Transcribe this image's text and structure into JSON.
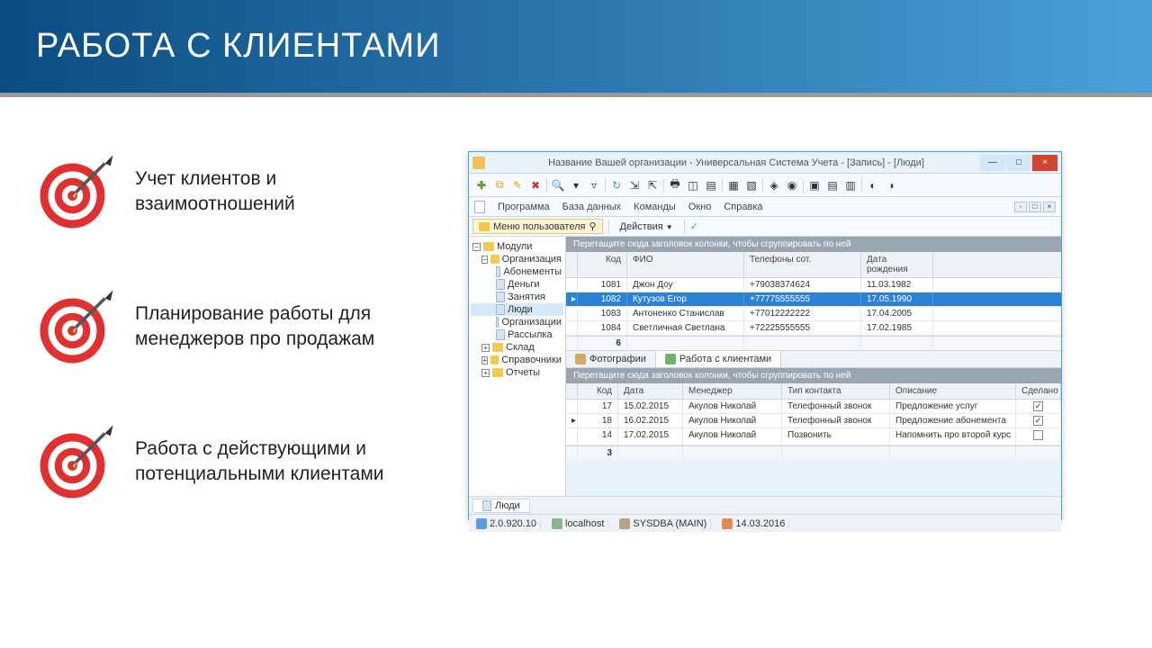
{
  "slide": {
    "title": "РАБОТА С КЛИЕНТАМИ",
    "bullets": [
      "Учет клиентов и взаимоотношений",
      "Планирование работы для менеджеров про продажам",
      "Работа с действующими и потенциальными клиентами"
    ]
  },
  "app": {
    "title": "Название Вашей организации - Универсальная Система Учета - [Запись] - [Люди]",
    "menus": [
      "Программа",
      "База данных",
      "Команды",
      "Окно",
      "Справка"
    ],
    "usermenu_label": "Меню пользователя",
    "actions_label": "Действия",
    "tree": {
      "root": "Модули",
      "org": "Организация",
      "org_children": [
        "Абонементы",
        "Деньги",
        "Занятия",
        "Люди",
        "Организации",
        "Рассылка"
      ],
      "others": [
        "Склад",
        "Справочники",
        "Отчеты"
      ]
    },
    "group_hint": "Перетащите сюда заголовок колонки, чтобы сгруппировать по ней",
    "grid1": {
      "cols": [
        "Код",
        "ФИО",
        "Телефоны сот.",
        "Дата рождения"
      ],
      "rows": [
        {
          "code": "1081",
          "fio": "Джон Доу",
          "tel": "+79038374624",
          "date": "11.03.1982",
          "sel": false
        },
        {
          "code": "1082",
          "fio": "Кутузов Егор",
          "tel": "+77775555555",
          "date": "17.05.1990",
          "sel": true
        },
        {
          "code": "1083",
          "fio": "Антоненко Станислав",
          "tel": "+77012222222",
          "date": "17.04.2005",
          "sel": false
        },
        {
          "code": "1084",
          "fio": "Светличная Светлана",
          "tel": "+72225555555",
          "date": "17.02.1985",
          "sel": false
        }
      ],
      "footer_count": "6"
    },
    "tabs": [
      "Фотографии",
      "Работа с клиентами"
    ],
    "grid2": {
      "cols": [
        "Код",
        "Дата",
        "Менеджер",
        "Тип контакта",
        "Описание",
        "Сделано"
      ],
      "rows": [
        {
          "code": "17",
          "date": "15.02.2015",
          "mgr": "Акулов Николай",
          "type": "Телефонный звонок",
          "desc": "Предложение услуг",
          "done": true
        },
        {
          "code": "18",
          "date": "16.02.2015",
          "mgr": "Акулов Николай",
          "type": "Телефонный звонок",
          "desc": "Предложение абонемента",
          "done": true
        },
        {
          "code": "14",
          "date": "17.02.2015",
          "mgr": "Акулов Николай",
          "type": "Позвонить",
          "desc": "Напомнить про второй курс",
          "done": false
        }
      ],
      "footer_count": "3"
    },
    "bottom_tab": "Люди",
    "status": {
      "version": "2.0.920.10",
      "host": "localhost",
      "user": "SYSDBA (MAIN)",
      "date": "14.03.2016"
    }
  }
}
